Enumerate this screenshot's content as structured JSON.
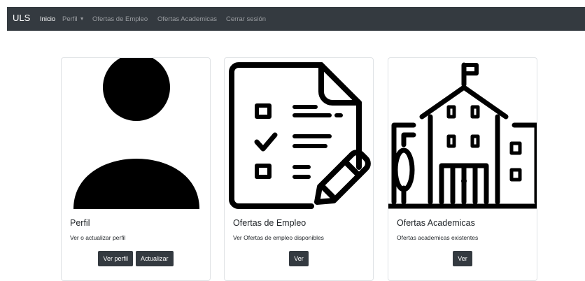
{
  "navbar": {
    "brand": "ULS",
    "items": [
      {
        "label": "Inicio",
        "active": true
      },
      {
        "label": "Perfil",
        "dropdown": true
      },
      {
        "label": "Ofertas de Empleo"
      },
      {
        "label": "Ofertas Academicas"
      },
      {
        "label": "Cerrar sesión"
      }
    ]
  },
  "cards": [
    {
      "icon": "user-icon",
      "title": "Perfil",
      "text": "Ver o actualizar perfil",
      "buttons": [
        "Ver perfil",
        "Actualizar"
      ]
    },
    {
      "icon": "checklist-document-icon",
      "title": "Ofertas de Empleo",
      "text": "Ver Ofertas de empleo disponibles",
      "buttons": [
        "Ver"
      ]
    },
    {
      "icon": "school-building-icon",
      "title": "Ofertas Academicas",
      "text": "Ofertas academicas existentes",
      "buttons": [
        "Ver"
      ]
    }
  ],
  "colors": {
    "navbar_bg": "#343a40",
    "button_bg": "#343a40",
    "nav_inactive": "#9a9da1"
  }
}
